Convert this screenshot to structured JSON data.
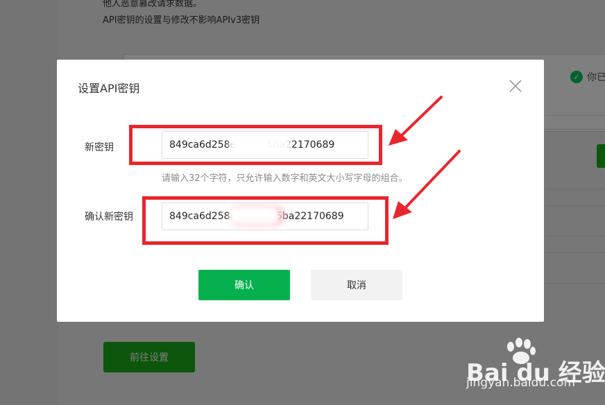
{
  "background": {
    "text_line1": "他人恶意篡改请求数据。",
    "text_line2": "API密钥的设置与修改不影响APIv3密钥",
    "verified_label": "你已",
    "goto_settings_label": "前往设置"
  },
  "modal": {
    "title": "设置API密钥",
    "new_key_label": "新密钥",
    "new_key_value": "849ca6d258e          5ba22170689",
    "hint": "请输入32个字符，只允许输入数字和英文大小写字母的组合。",
    "confirm_key_label": "确认新密钥",
    "confirm_key_value": "849ca6d258e           05ba22170689",
    "confirm_button": "确认",
    "cancel_button": "取消"
  },
  "watermark": {
    "logo_text": "Bai du 经验",
    "url": "jingyan.baidu.com"
  },
  "colors": {
    "primary_green": "#07b04f",
    "annotation_red": "#e8262d"
  }
}
